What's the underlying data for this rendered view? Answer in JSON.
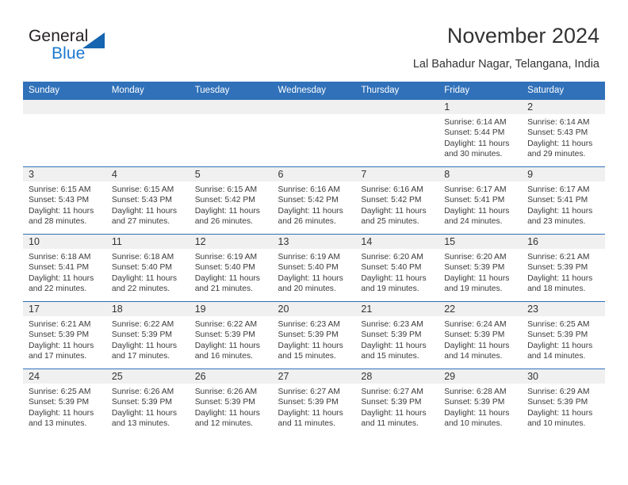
{
  "brand": {
    "name_part1": "General",
    "name_part2": "Blue",
    "triangle_color": "#1565b0",
    "blue_color": "#1b79cf"
  },
  "header": {
    "title": "November 2024",
    "location": "Lal Bahadur Nagar, Telangana, India"
  },
  "theme": {
    "header_row_bg": "#3071b9",
    "header_row_text": "#ffffff",
    "daynum_strip_bg": "#f0f0f0",
    "row_border": "#3071b9",
    "body_text": "#3a3a3a"
  },
  "weekday_headers": [
    "Sunday",
    "Monday",
    "Tuesday",
    "Wednesday",
    "Thursday",
    "Friday",
    "Saturday"
  ],
  "labels": {
    "sunrise_prefix": "Sunrise:",
    "sunset_prefix": "Sunset:",
    "daylight_prefix": "Daylight:"
  },
  "weeks": [
    [
      {
        "day": "",
        "empty": true,
        "l1": "",
        "l2": "",
        "l3": "",
        "l4": ""
      },
      {
        "day": "",
        "empty": true,
        "l1": "",
        "l2": "",
        "l3": "",
        "l4": ""
      },
      {
        "day": "",
        "empty": true,
        "l1": "",
        "l2": "",
        "l3": "",
        "l4": ""
      },
      {
        "day": "",
        "empty": true,
        "l1": "",
        "l2": "",
        "l3": "",
        "l4": ""
      },
      {
        "day": "",
        "empty": true,
        "l1": "",
        "l2": "",
        "l3": "",
        "l4": ""
      },
      {
        "day": "1",
        "empty": false,
        "l1": "Sunrise: 6:14 AM",
        "l2": "Sunset: 5:44 PM",
        "l3": "Daylight: 11 hours",
        "l4": "and 30 minutes."
      },
      {
        "day": "2",
        "empty": false,
        "l1": "Sunrise: 6:14 AM",
        "l2": "Sunset: 5:43 PM",
        "l3": "Daylight: 11 hours",
        "l4": "and 29 minutes."
      }
    ],
    [
      {
        "day": "3",
        "empty": false,
        "l1": "Sunrise: 6:15 AM",
        "l2": "Sunset: 5:43 PM",
        "l3": "Daylight: 11 hours",
        "l4": "and 28 minutes."
      },
      {
        "day": "4",
        "empty": false,
        "l1": "Sunrise: 6:15 AM",
        "l2": "Sunset: 5:43 PM",
        "l3": "Daylight: 11 hours",
        "l4": "and 27 minutes."
      },
      {
        "day": "5",
        "empty": false,
        "l1": "Sunrise: 6:15 AM",
        "l2": "Sunset: 5:42 PM",
        "l3": "Daylight: 11 hours",
        "l4": "and 26 minutes."
      },
      {
        "day": "6",
        "empty": false,
        "l1": "Sunrise: 6:16 AM",
        "l2": "Sunset: 5:42 PM",
        "l3": "Daylight: 11 hours",
        "l4": "and 26 minutes."
      },
      {
        "day": "7",
        "empty": false,
        "l1": "Sunrise: 6:16 AM",
        "l2": "Sunset: 5:42 PM",
        "l3": "Daylight: 11 hours",
        "l4": "and 25 minutes."
      },
      {
        "day": "8",
        "empty": false,
        "l1": "Sunrise: 6:17 AM",
        "l2": "Sunset: 5:41 PM",
        "l3": "Daylight: 11 hours",
        "l4": "and 24 minutes."
      },
      {
        "day": "9",
        "empty": false,
        "l1": "Sunrise: 6:17 AM",
        "l2": "Sunset: 5:41 PM",
        "l3": "Daylight: 11 hours",
        "l4": "and 23 minutes."
      }
    ],
    [
      {
        "day": "10",
        "empty": false,
        "l1": "Sunrise: 6:18 AM",
        "l2": "Sunset: 5:41 PM",
        "l3": "Daylight: 11 hours",
        "l4": "and 22 minutes."
      },
      {
        "day": "11",
        "empty": false,
        "l1": "Sunrise: 6:18 AM",
        "l2": "Sunset: 5:40 PM",
        "l3": "Daylight: 11 hours",
        "l4": "and 22 minutes."
      },
      {
        "day": "12",
        "empty": false,
        "l1": "Sunrise: 6:19 AM",
        "l2": "Sunset: 5:40 PM",
        "l3": "Daylight: 11 hours",
        "l4": "and 21 minutes."
      },
      {
        "day": "13",
        "empty": false,
        "l1": "Sunrise: 6:19 AM",
        "l2": "Sunset: 5:40 PM",
        "l3": "Daylight: 11 hours",
        "l4": "and 20 minutes."
      },
      {
        "day": "14",
        "empty": false,
        "l1": "Sunrise: 6:20 AM",
        "l2": "Sunset: 5:40 PM",
        "l3": "Daylight: 11 hours",
        "l4": "and 19 minutes."
      },
      {
        "day": "15",
        "empty": false,
        "l1": "Sunrise: 6:20 AM",
        "l2": "Sunset: 5:39 PM",
        "l3": "Daylight: 11 hours",
        "l4": "and 19 minutes."
      },
      {
        "day": "16",
        "empty": false,
        "l1": "Sunrise: 6:21 AM",
        "l2": "Sunset: 5:39 PM",
        "l3": "Daylight: 11 hours",
        "l4": "and 18 minutes."
      }
    ],
    [
      {
        "day": "17",
        "empty": false,
        "l1": "Sunrise: 6:21 AM",
        "l2": "Sunset: 5:39 PM",
        "l3": "Daylight: 11 hours",
        "l4": "and 17 minutes."
      },
      {
        "day": "18",
        "empty": false,
        "l1": "Sunrise: 6:22 AM",
        "l2": "Sunset: 5:39 PM",
        "l3": "Daylight: 11 hours",
        "l4": "and 17 minutes."
      },
      {
        "day": "19",
        "empty": false,
        "l1": "Sunrise: 6:22 AM",
        "l2": "Sunset: 5:39 PM",
        "l3": "Daylight: 11 hours",
        "l4": "and 16 minutes."
      },
      {
        "day": "20",
        "empty": false,
        "l1": "Sunrise: 6:23 AM",
        "l2": "Sunset: 5:39 PM",
        "l3": "Daylight: 11 hours",
        "l4": "and 15 minutes."
      },
      {
        "day": "21",
        "empty": false,
        "l1": "Sunrise: 6:23 AM",
        "l2": "Sunset: 5:39 PM",
        "l3": "Daylight: 11 hours",
        "l4": "and 15 minutes."
      },
      {
        "day": "22",
        "empty": false,
        "l1": "Sunrise: 6:24 AM",
        "l2": "Sunset: 5:39 PM",
        "l3": "Daylight: 11 hours",
        "l4": "and 14 minutes."
      },
      {
        "day": "23",
        "empty": false,
        "l1": "Sunrise: 6:25 AM",
        "l2": "Sunset: 5:39 PM",
        "l3": "Daylight: 11 hours",
        "l4": "and 14 minutes."
      }
    ],
    [
      {
        "day": "24",
        "empty": false,
        "l1": "Sunrise: 6:25 AM",
        "l2": "Sunset: 5:39 PM",
        "l3": "Daylight: 11 hours",
        "l4": "and 13 minutes."
      },
      {
        "day": "25",
        "empty": false,
        "l1": "Sunrise: 6:26 AM",
        "l2": "Sunset: 5:39 PM",
        "l3": "Daylight: 11 hours",
        "l4": "and 13 minutes."
      },
      {
        "day": "26",
        "empty": false,
        "l1": "Sunrise: 6:26 AM",
        "l2": "Sunset: 5:39 PM",
        "l3": "Daylight: 11 hours",
        "l4": "and 12 minutes."
      },
      {
        "day": "27",
        "empty": false,
        "l1": "Sunrise: 6:27 AM",
        "l2": "Sunset: 5:39 PM",
        "l3": "Daylight: 11 hours",
        "l4": "and 11 minutes."
      },
      {
        "day": "28",
        "empty": false,
        "l1": "Sunrise: 6:27 AM",
        "l2": "Sunset: 5:39 PM",
        "l3": "Daylight: 11 hours",
        "l4": "and 11 minutes."
      },
      {
        "day": "29",
        "empty": false,
        "l1": "Sunrise: 6:28 AM",
        "l2": "Sunset: 5:39 PM",
        "l3": "Daylight: 11 hours",
        "l4": "and 10 minutes."
      },
      {
        "day": "30",
        "empty": false,
        "l1": "Sunrise: 6:29 AM",
        "l2": "Sunset: 5:39 PM",
        "l3": "Daylight: 11 hours",
        "l4": "and 10 minutes."
      }
    ]
  ]
}
